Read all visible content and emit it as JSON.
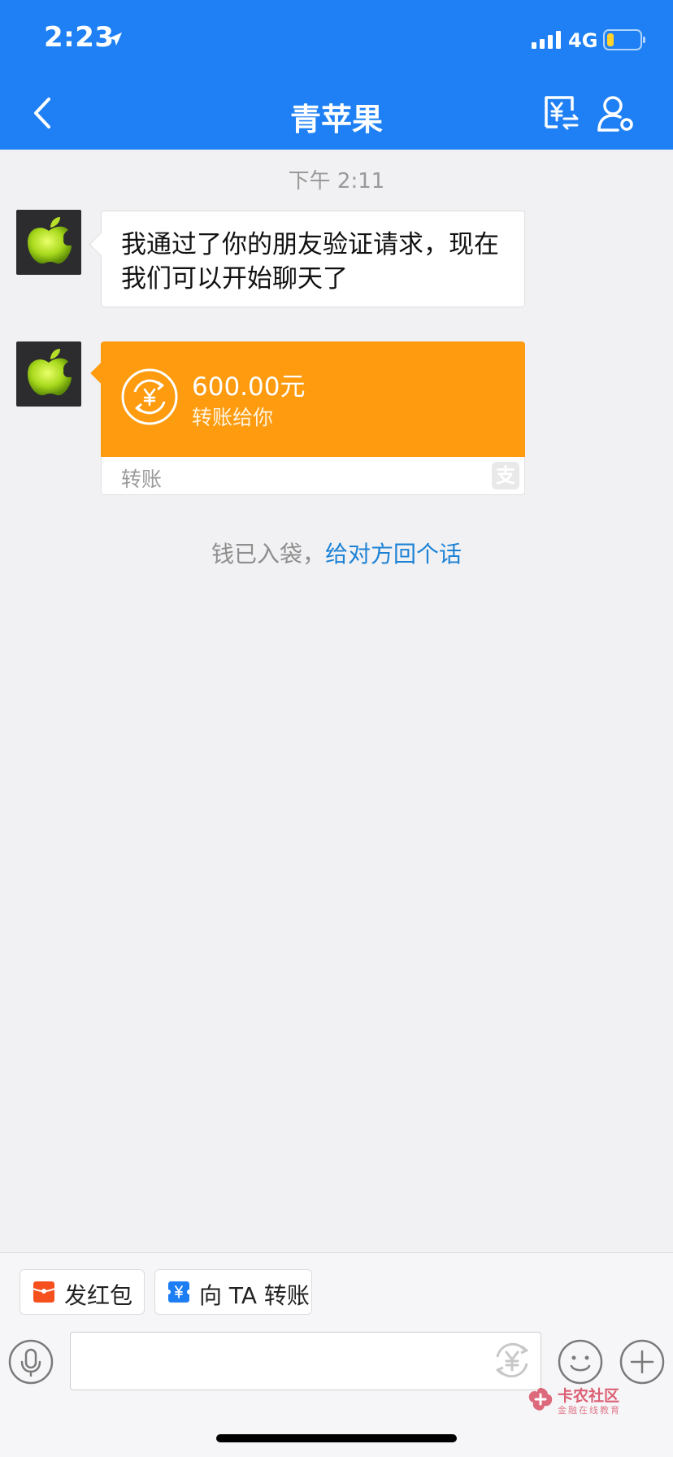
{
  "status_bar": {
    "time": "2:23",
    "network": "4G"
  },
  "nav": {
    "title": "青苹果",
    "icons": [
      "back-chevron-icon",
      "yen-transfer-icon",
      "user-settings-icon"
    ]
  },
  "chat": {
    "timestamp": "下午 2:11",
    "messages": [
      {
        "type": "text",
        "text": "我通过了你的朋友验证请求，现在我们可以开始聊天了"
      },
      {
        "type": "transfer",
        "amount": "600.00元",
        "subtitle": "转账给你",
        "footer_label": "转账",
        "icons": [
          "yen-circle-icon",
          "alipay-icon"
        ]
      }
    ],
    "notice": {
      "prefix": "钱已入袋，",
      "link": "给对方回个话"
    }
  },
  "bottom_bar": {
    "quick_actions": [
      {
        "label": "发红包",
        "icon": "red-packet-icon"
      },
      {
        "label": "向 TA 转账",
        "icon": "transfer-ticket-icon"
      }
    ],
    "input": {
      "value": "",
      "placeholder": ""
    },
    "icons": [
      "microphone-icon",
      "yen-icon",
      "emoji-icon",
      "plus-icon"
    ]
  },
  "watermark": {
    "title": "卡农社区",
    "subtitle": "金融在线教育"
  },
  "colors": {
    "header": "#1e80f4",
    "transfer_card": "#fe9b0e",
    "link": "#1d82d6",
    "battery": "#ffd22e"
  }
}
